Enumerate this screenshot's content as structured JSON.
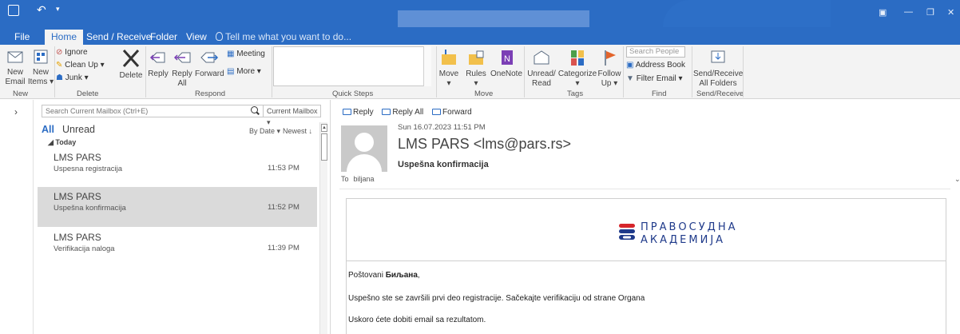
{
  "titlebar": {
    "undo_glyph": "↶",
    "drop_glyph": "▾",
    "win_controls": [
      "▣",
      "—",
      "❐",
      "✕"
    ]
  },
  "tabs": [
    {
      "label": "File"
    },
    {
      "label": "Home"
    },
    {
      "label": "Send / Receive"
    },
    {
      "label": "Folder"
    },
    {
      "label": "View"
    }
  ],
  "tell_me": "Tell me what you want to do...",
  "ribbon": {
    "new_email": "New\nEmail",
    "new_items": "New\nItems ▾",
    "ignore": "Ignore",
    "clean_up": "Clean Up ▾",
    "junk": "Junk ▾",
    "delete": "Delete",
    "reply": "Reply",
    "reply_all": "Reply\nAll",
    "forward": "Forward",
    "meeting": "Meeting",
    "more": "More ▾",
    "move": "Move\n▾",
    "rules": "Rules\n▾",
    "onenote": "OneNote",
    "unread_read": "Unread/\nRead",
    "categorize": "Categorize\n▾",
    "follow_up": "Follow\nUp ▾",
    "search_people": "Search People",
    "address_book": "Address Book",
    "filter_email": "Filter Email ▾",
    "send_receive_all": "Send/Receive\nAll Folders",
    "groups": {
      "new": "New",
      "delete": "Delete",
      "respond": "Respond",
      "quick_steps": "Quick Steps",
      "move": "Move",
      "tags": "Tags",
      "find": "Find",
      "send_receive": "Send/Receive"
    }
  },
  "nav": {
    "expand_glyph": "›"
  },
  "list": {
    "search_placeholder": "Search Current Mailbox (Ctrl+E)",
    "scope": "Current Mailbox ▾",
    "filter_all": "All",
    "filter_unread": "Unread",
    "sort_by": "By Date ▾",
    "sort_order": "Newest ↓",
    "group_today": "◢ Today",
    "items": [
      {
        "sender": "LMS PARS",
        "subject": "Uspesna registracija",
        "time": "11:53 PM"
      },
      {
        "sender": "LMS PARS",
        "subject": "Uspešna konfirmacija",
        "time": "11:52 PM"
      },
      {
        "sender": "LMS PARS",
        "subject": "Verifikacija naloga",
        "time": "11:39 PM"
      }
    ]
  },
  "reading": {
    "actions": {
      "reply": "Reply",
      "reply_all": "Reply All",
      "forward": "Forward"
    },
    "date": "Sun 16.07.2023 11:51 PM",
    "from": "LMS PARS <lms@pars.rs>",
    "subject": "Uspešna konfirmacija",
    "to_label": "To",
    "to_value": "biljana",
    "email": {
      "logo_line1": "ПРАВОСУДНА",
      "logo_line2": "АКАДЕМИЈА",
      "greeting_prefix": "Poštovani ",
      "greeting_name": "Биљана",
      "greeting_suffix": ",",
      "line1": "Uspešno ste se završili prvi deo registracije. Sačekajte verifikaciju od strane Organa",
      "line2": "Uskoro ćete dobiti email sa rezultatom."
    }
  },
  "colors": {
    "brand_blue": "#2b6cc4",
    "selected_row": "#dadada"
  }
}
